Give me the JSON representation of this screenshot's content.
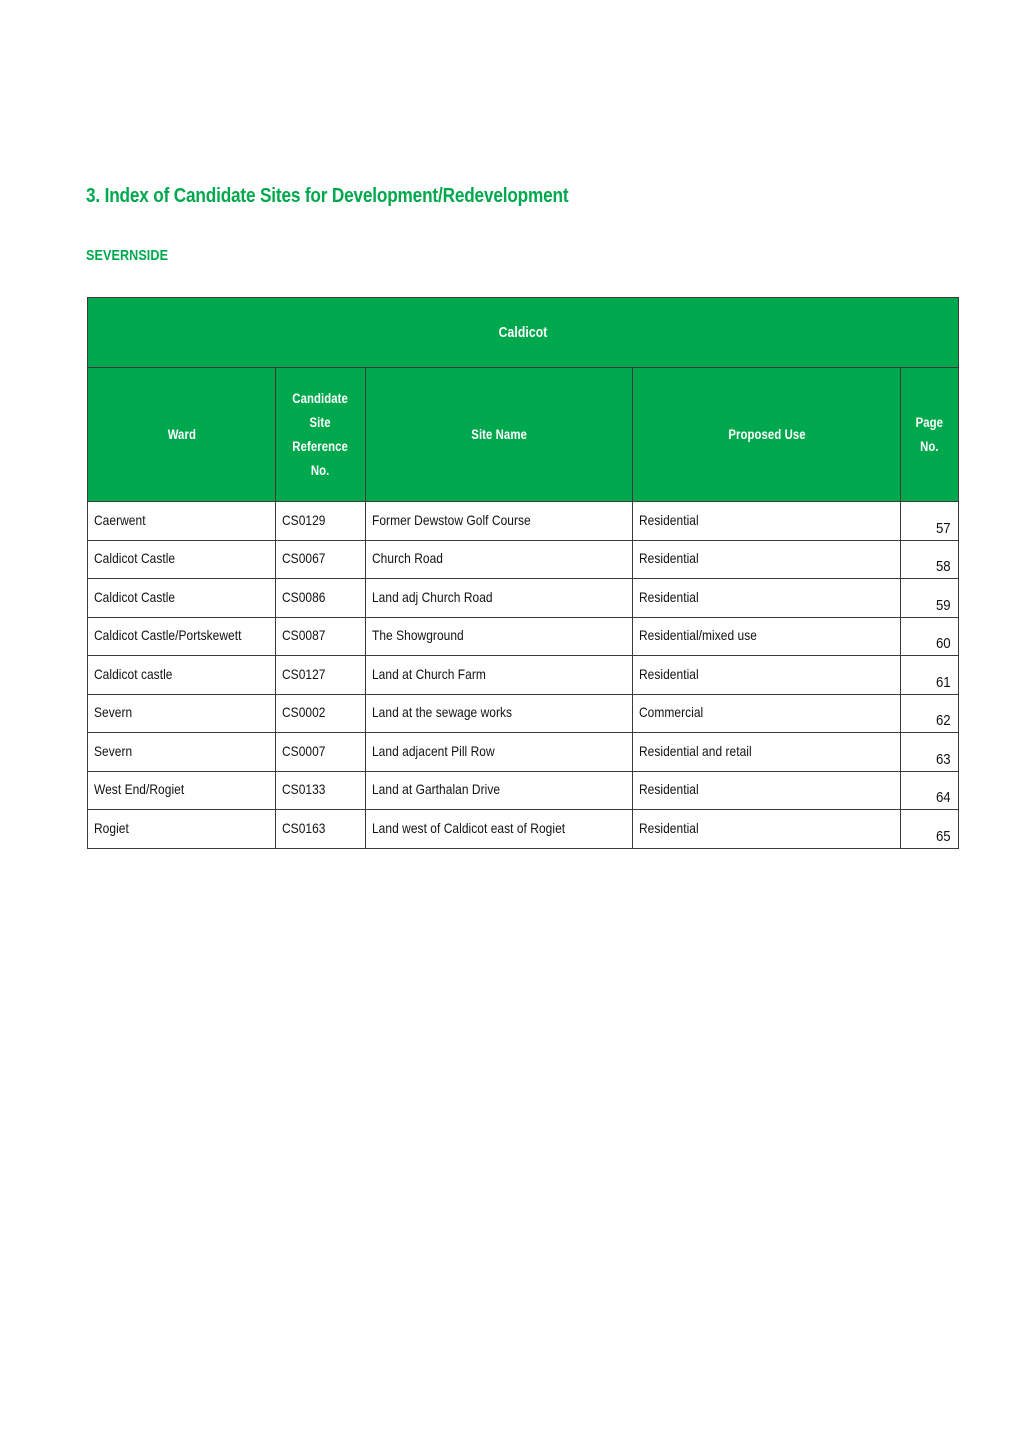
{
  "document": {
    "heading": "3. Index of Candidate Sites for Development/Redevelopment",
    "section_label": "SEVERNSIDE",
    "accent_color": "#00A84D",
    "text_color": "#121212",
    "border_color": "#3b3b3b"
  },
  "table": {
    "group_title": "Caldicot",
    "columns": [
      {
        "key": "ward",
        "label": "Ward"
      },
      {
        "key": "reference",
        "label": "Candidate\nSite\nReference\nNo."
      },
      {
        "key": "site_name",
        "label": "Site Name"
      },
      {
        "key": "proposed_use",
        "label": "Proposed Use"
      },
      {
        "key": "page_no",
        "label": "Page\nNo."
      }
    ],
    "rows": [
      {
        "ward": "Caerwent",
        "reference": "CS0129",
        "site_name": "Former Dewstow Golf Course",
        "proposed_use": "Residential",
        "page_no": "57"
      },
      {
        "ward": "Caldicot Castle",
        "reference": "CS0067",
        "site_name": "Church Road",
        "proposed_use": "Residential",
        "page_no": "58"
      },
      {
        "ward": "Caldicot Castle",
        "reference": "CS0086",
        "site_name": "Land adj Church Road",
        "proposed_use": "Residential",
        "page_no": "59"
      },
      {
        "ward": "Caldicot Castle/Portskewett",
        "reference": "CS0087",
        "site_name": "The Showground",
        "proposed_use": "Residential/mixed use",
        "page_no": "60"
      },
      {
        "ward": "Caldicot castle",
        "reference": "CS0127",
        "site_name": "Land at Church Farm",
        "proposed_use": "Residential",
        "page_no": "61"
      },
      {
        "ward": "Severn",
        "reference": "CS0002",
        "site_name": "Land at the sewage works",
        "proposed_use": "Commercial",
        "page_no": "62"
      },
      {
        "ward": "Severn",
        "reference": "CS0007",
        "site_name": "Land adjacent Pill Row",
        "proposed_use": "Residential and retail",
        "page_no": "63"
      },
      {
        "ward": "West End/Rogiet",
        "reference": "CS0133",
        "site_name": "Land at Garthalan Drive",
        "proposed_use": "Residential",
        "page_no": "64"
      },
      {
        "ward": "Rogiet",
        "reference": "CS0163",
        "site_name": "Land west of Caldicot east of Rogiet",
        "proposed_use": "Residential",
        "page_no": "65"
      }
    ]
  }
}
